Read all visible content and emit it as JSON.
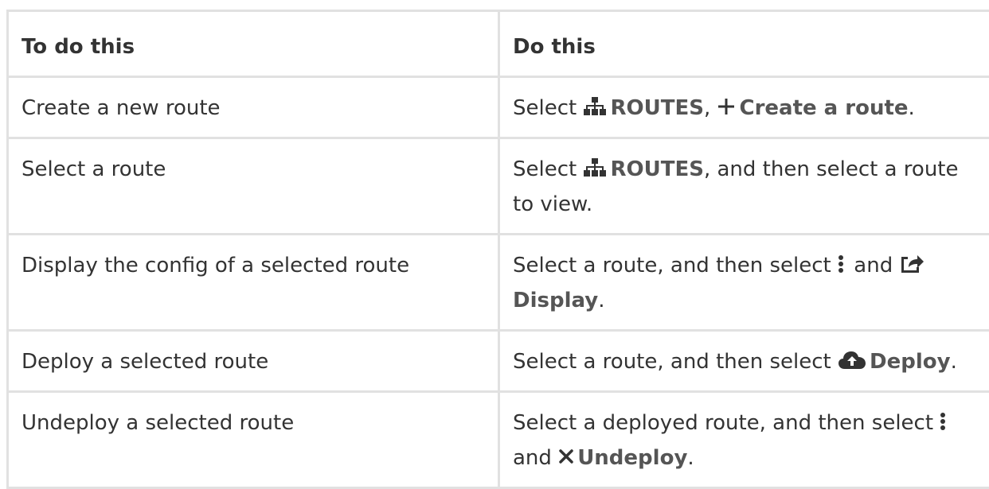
{
  "table": {
    "header": {
      "col1": "To do this",
      "col2": "Do this"
    },
    "rows": [
      {
        "task": "Create a new route",
        "select": "Select",
        "routes": "ROUTES",
        "sep": ",",
        "create": "Create a route",
        "end": "."
      },
      {
        "task": "Select a route",
        "select": "Select",
        "routes": "ROUTES",
        "rest": ", and then select a route to view."
      },
      {
        "task": "Display the config of a selected route",
        "pre": "Select a route, and then select",
        "mid": "and",
        "display": "Display",
        "end": "."
      },
      {
        "task": "Deploy a selected route",
        "pre": "Select a route, and then select",
        "deploy": "Deploy",
        "end": "."
      },
      {
        "task": "Undeploy a selected route",
        "pre": "Select a deployed route, and then select",
        "mid": "and",
        "undeploy": "Undeploy",
        "end": "."
      }
    ]
  },
  "icons": {
    "routes": "sitemap-icon",
    "create": "plus-icon",
    "more": "vertical-ellipsis-icon",
    "display": "share-icon",
    "deploy": "cloud-upload-icon",
    "undeploy": "close-icon"
  }
}
